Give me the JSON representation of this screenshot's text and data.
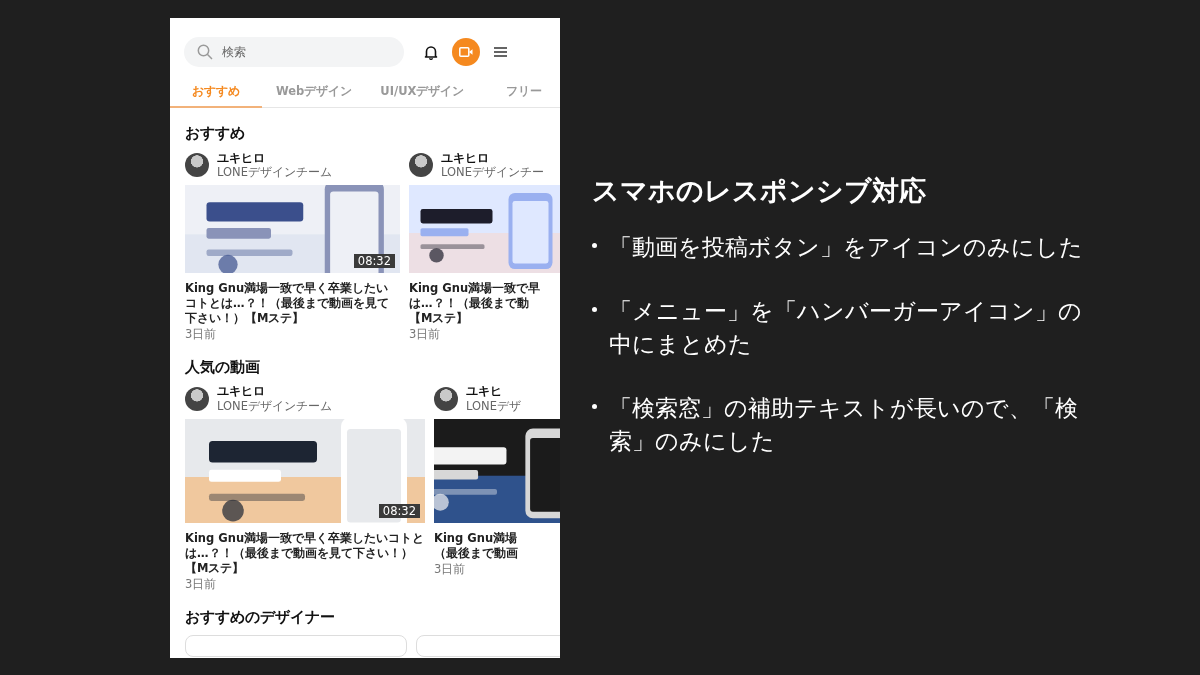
{
  "search": {
    "placeholder": "検索"
  },
  "tabs": [
    {
      "label": "おすすめ",
      "selected": true
    },
    {
      "label": "Webデザイン",
      "selected": false
    },
    {
      "label": "UI/UXデザイン",
      "selected": false
    },
    {
      "label": "フリー",
      "selected": false
    }
  ],
  "sections": [
    {
      "heading": "おすすめ",
      "kind": "videos",
      "videos": [
        {
          "author": "ユキヒロ",
          "team": "LONEデザインチーム",
          "duration": "08:32",
          "title_lines": [
            "King Gnu満場一致で早く卒業したいコトとは…？！（最後まで動画を見て下さい！）【Mステ】"
          ],
          "age": "3日前"
        },
        {
          "author": "ユキヒロ",
          "team": "LONEデザインチー",
          "title_lines": [
            "King Gnu満場一致で早",
            "は…？！（最後まで動",
            "【Mステ】"
          ],
          "age": "3日前"
        }
      ]
    },
    {
      "heading": "人気の動画",
      "kind": "videos",
      "videos": [
        {
          "author": "ユキヒロ",
          "team": "LONEデザインチーム",
          "duration": "08:32",
          "title_lines": [
            "King Gnu満場一致で早く卒業したいコトとは…？！（最後まで動画を見て下さい！）【Mステ】"
          ],
          "age": "3日前"
        },
        {
          "author": "ユキヒ",
          "team": "LONEデザ",
          "title_lines": [
            "King Gnu満場",
            "（最後まで動画"
          ],
          "age": "3日前"
        }
      ]
    },
    {
      "heading": "おすすめのデザイナー",
      "kind": "designers"
    }
  ],
  "notes": {
    "title": "スマホのレスポンシブ対応",
    "bullets": [
      "「動画を投稿ボタン」をアイコンのみにした",
      "「メニュー」を「ハンバーガーアイコン」の中にまとめた",
      "「検索窓」の補助テキストが長いので、「検索」のみにした"
    ]
  }
}
